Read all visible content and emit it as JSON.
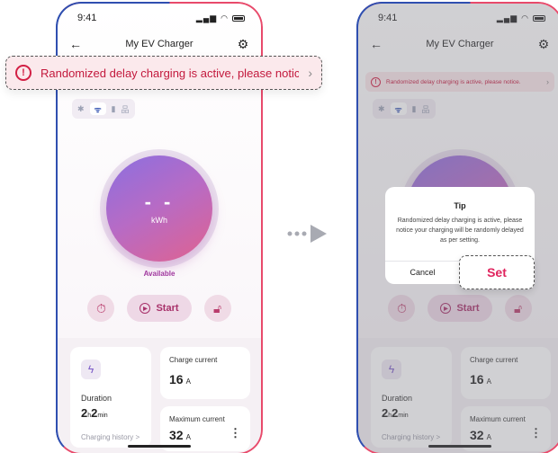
{
  "status": {
    "time": "9:41"
  },
  "nav": {
    "title": "My EV Charger"
  },
  "banner": {
    "text": "Randomized delay charging is active, please notice..",
    "text_short": "Randomized delay charging is active, please notice."
  },
  "gauge": {
    "energy": "- -",
    "unit": "kWh",
    "state": "Available"
  },
  "controls": {
    "start_label": "Start"
  },
  "stats": {
    "duration_label": "Duration",
    "duration_hours": "2",
    "duration_h_unit": "h",
    "duration_minutes": "2",
    "duration_min_unit": "min",
    "history_link": "Charging history  >",
    "charge_current_label": "Charge current",
    "charge_current_value": "16",
    "charge_current_unit": "A",
    "max_current_label": "Maximum current",
    "max_current_value": "32",
    "max_current_unit": "A"
  },
  "dialog": {
    "title": "Tip",
    "body": "Randomized delay charging is active, please notice your charging will be randomly delayed as per setting.",
    "cancel_label": "Cancel",
    "set_label": "Set"
  },
  "colors": {
    "accent": "#e0245e",
    "warning": "#d21f44",
    "primary": "#7a59c7"
  },
  "icons": [
    "back-arrow-icon",
    "gear-icon",
    "warning-icon",
    "chevron-right-icon",
    "bluetooth-icon",
    "wifi-icon",
    "cellular-icon",
    "ethernet-icon",
    "timer-icon",
    "play-icon",
    "lock-icon",
    "lightning-icon",
    "more-icon"
  ]
}
